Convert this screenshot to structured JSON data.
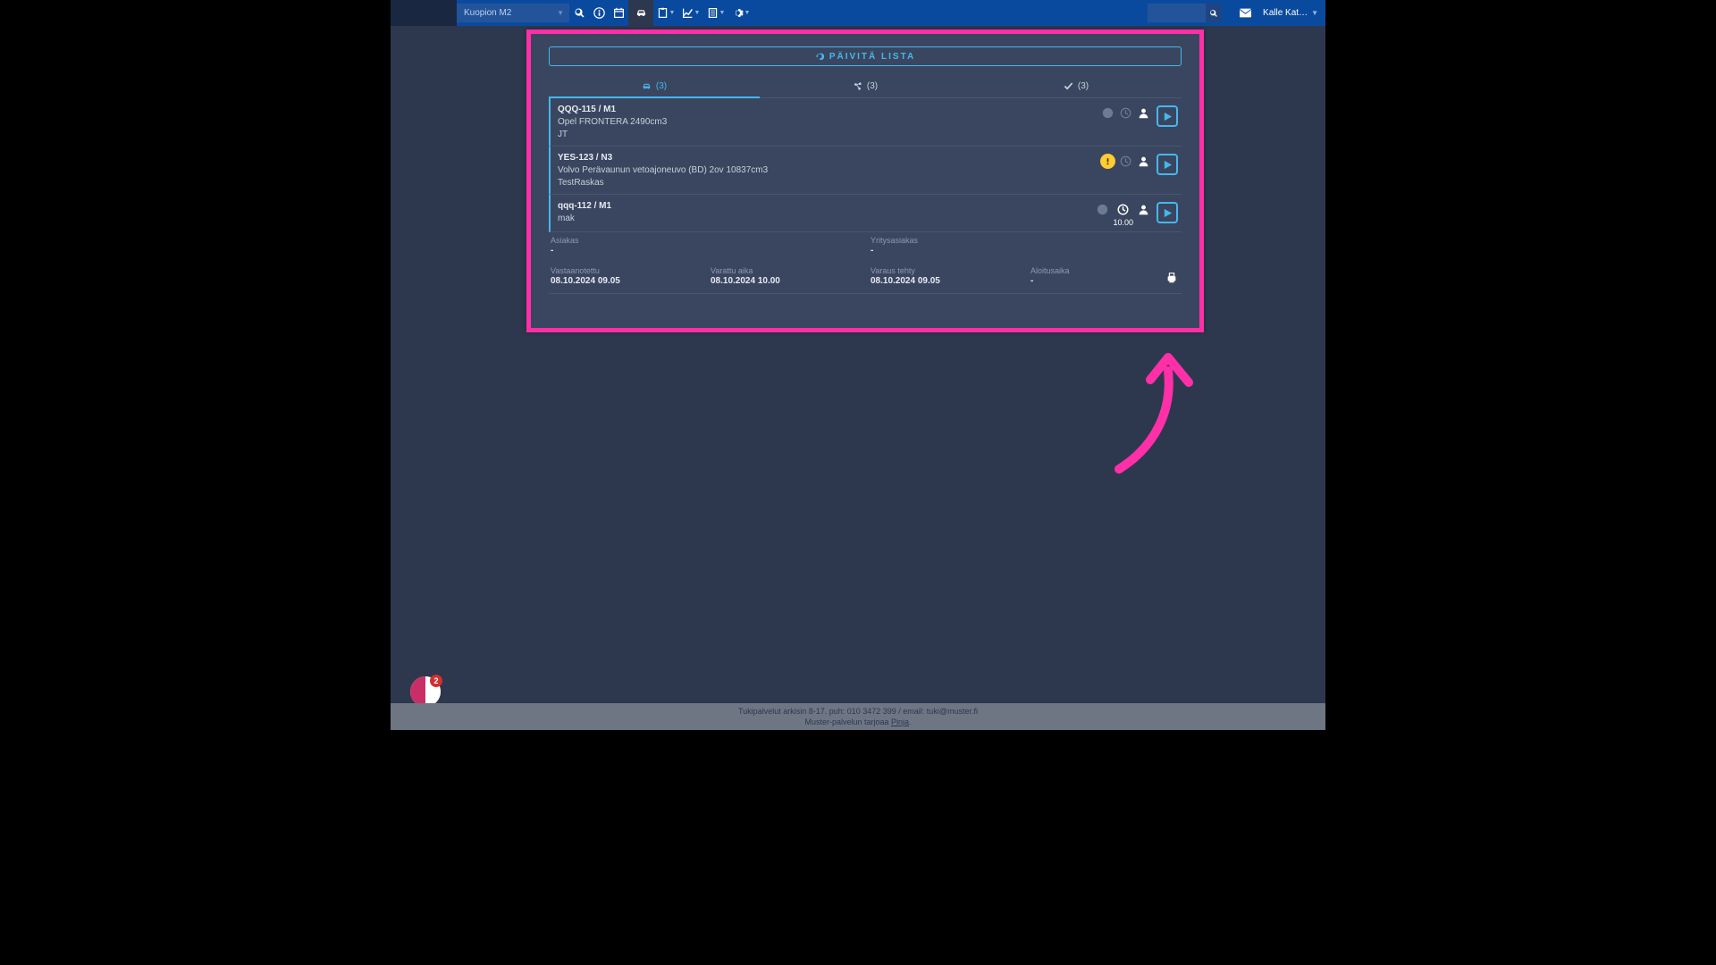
{
  "nav": {
    "location": "Kuopion M2",
    "user": "Kalle Kat…",
    "search_placeholder": ""
  },
  "panel": {
    "refresh_label": "PÄIVITÄ LISTA",
    "tabs": [
      {
        "count": "(3)"
      },
      {
        "count": "(3)"
      },
      {
        "count": "(3)"
      }
    ],
    "rows": [
      {
        "reg": "QQQ-115 / M1",
        "desc": "Opel FRONTERA 2490cm3",
        "owner": "JT",
        "info": "dim",
        "clock": "dim",
        "time": ""
      },
      {
        "reg": "YES-123 / N3",
        "desc": "Volvo Perävaunun vetoajoneuvo (BD) 2ov 10837cm3",
        "owner": "TestRaskas",
        "info": "warn",
        "clock": "dim",
        "time": ""
      },
      {
        "reg": "qqq-112 / M1",
        "desc": "",
        "owner": "mak",
        "info": "dim",
        "clock": "act",
        "time": "10.00"
      }
    ],
    "details": {
      "asiakas_lbl": "Asiakas",
      "asiakas_val": "-",
      "yritys_lbl": "Yritysasiakas",
      "yritys_val": "-",
      "vast_lbl": "Vastaanotettu",
      "vast_val": "08.10.2024 09.05",
      "varattu_lbl": "Varattu aika",
      "varattu_val": "08.10.2024 10.00",
      "varus_lbl": "Varaus tehty",
      "varus_val": "08.10.2024 09.05",
      "aloitus_lbl": "Aloitusaika",
      "aloitus_val": "-"
    }
  },
  "footer": {
    "line1": "Tukipalvelut arkisin 8-17. puh: 010 3472 399 / email: tuki@muster.fi",
    "line2a": "Muster-palvelun tarjoaa ",
    "line2b": "Pinja",
    "line2c": "."
  },
  "badge_count": "2"
}
